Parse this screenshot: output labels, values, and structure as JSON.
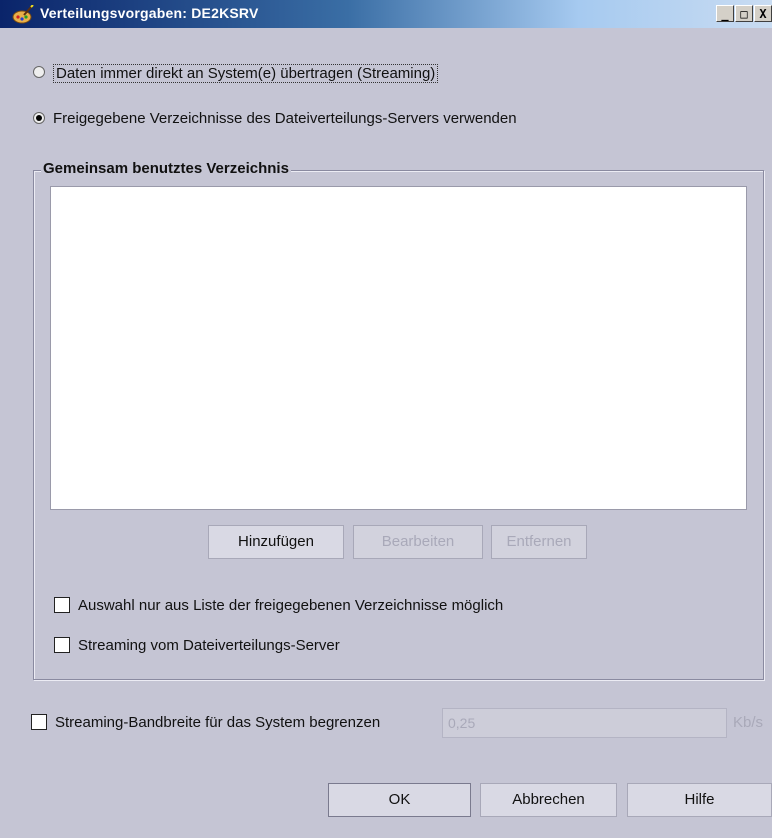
{
  "window": {
    "title": "Verteilungsvorgaben: DE2KSRV",
    "controls": {
      "minimize": "_",
      "maximize": "□",
      "close": "X"
    }
  },
  "options": {
    "streaming_label": "Daten immer direkt an System(e) übertragen (Streaming)",
    "streaming_selected": false,
    "shared_label": "Freigegebene Verzeichnisse des Dateiverteilungs-Servers verwenden",
    "shared_selected": true
  },
  "shared_dir_group": {
    "title": "Gemeinsam benutztes Verzeichnis",
    "list_items": [],
    "buttons": {
      "add": "Hinzufügen",
      "edit": "Bearbeiten",
      "remove": "Entfernen"
    },
    "checkbox_list_only": "Auswahl nur aus Liste der freigegebenen Verzeichnisse möglich",
    "checkbox_list_only_checked": false,
    "checkbox_stream_from_server": "Streaming vom Dateiverteilungs-Server",
    "checkbox_stream_from_server_checked": false
  },
  "bandwidth": {
    "label": "Streaming-Bandbreite für das System begrenzen",
    "checked": false,
    "value": "0,25",
    "unit": "Kb/s"
  },
  "footer": {
    "ok": "OK",
    "cancel": "Abbrechen",
    "help": "Hilfe"
  },
  "colors": {
    "background": "#c5c5d4",
    "titlebar_start": "#0a246a",
    "titlebar_end": "#c9dcf2",
    "disabled_text": "#a9a9b9"
  },
  "icons": {
    "app": "palette-brush-icon"
  }
}
